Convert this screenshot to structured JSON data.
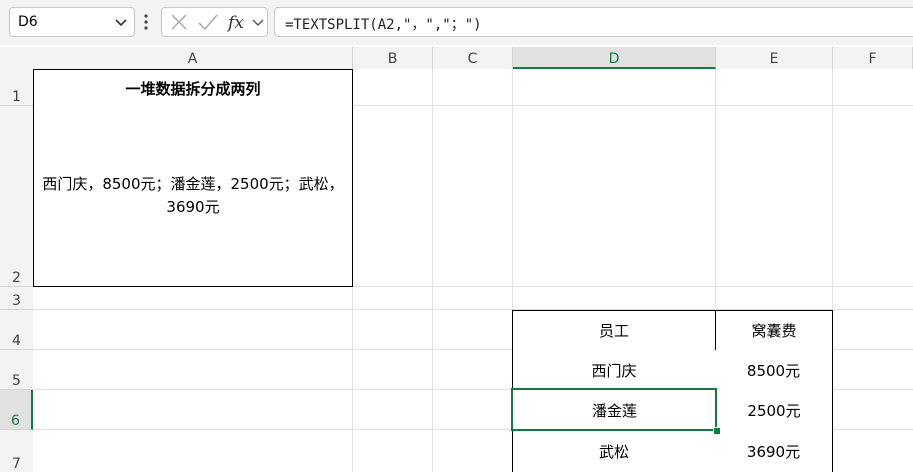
{
  "name_box": {
    "value": "D6"
  },
  "formula_bar": {
    "formula": "=TEXTSPLIT(A2,\"，\",\"；\")"
  },
  "icons": {
    "namebox_dropdown": "chevron-down-icon",
    "more": "vertical-dots-icon",
    "cancel": "close-icon",
    "enter": "check-icon",
    "function": "fx-icon",
    "function_dropdown": "chevron-down-icon"
  },
  "columns": [
    "A",
    "B",
    "C",
    "D",
    "E",
    "F"
  ],
  "rows": [
    "1",
    "2",
    "3",
    "4",
    "5",
    "6",
    "7"
  ],
  "selected_cell": {
    "column": "D",
    "row": "6"
  },
  "cells": {
    "A1": "一堆数据拆分成两列",
    "A2": "西门庆，8500元；潘金莲，2500元；武松，3690元",
    "D4": "员工",
    "E4": "窝囊费",
    "D5": "西门庆",
    "E5": "8500元",
    "D6": "潘金莲",
    "E6": "2500元",
    "D7": "武松",
    "E7": "3690元"
  },
  "colors": {
    "accent": "#107c41",
    "spill_border": "#4472c4"
  }
}
